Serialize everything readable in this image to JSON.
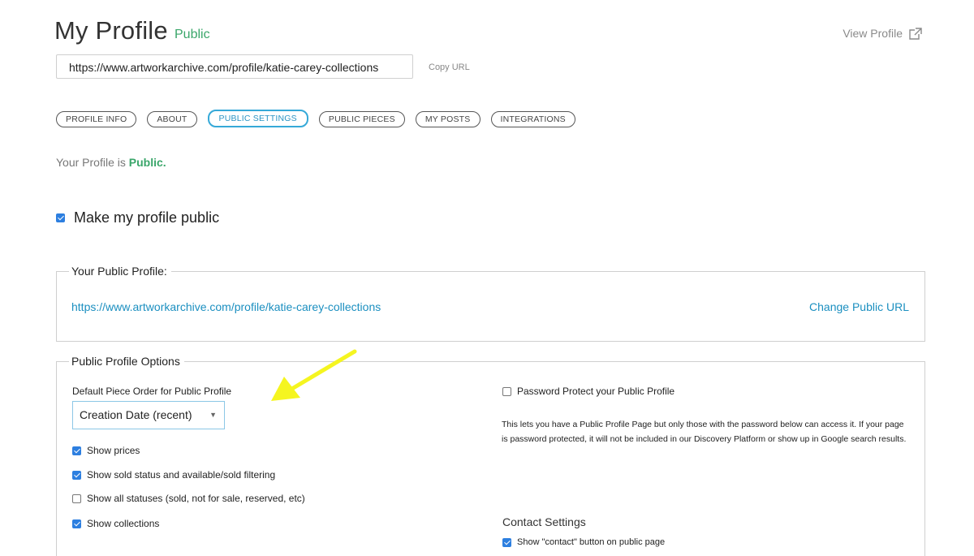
{
  "header": {
    "title": "My Profile",
    "status": "Public",
    "view_profile": "View Profile"
  },
  "url_bar": {
    "value": "https://www.artworkarchive.com/profile/katie-carey-collections",
    "copy_label": "Copy URL"
  },
  "tabs": [
    {
      "label": "PROFILE INFO",
      "active": false
    },
    {
      "label": "ABOUT",
      "active": false
    },
    {
      "label": "PUBLIC SETTINGS",
      "active": true
    },
    {
      "label": "PUBLIC PIECES",
      "active": false
    },
    {
      "label": "MY POSTS",
      "active": false
    },
    {
      "label": "INTEGRATIONS",
      "active": false
    }
  ],
  "profile_status": {
    "prefix": "Your Profile is",
    "value": "Public."
  },
  "make_public": {
    "label": "Make my profile public",
    "checked": true
  },
  "public_profile": {
    "legend": "Your Public Profile:",
    "url": "https://www.artworkarchive.com/profile/katie-carey-collections",
    "change_label": "Change Public URL"
  },
  "options": {
    "legend": "Public Profile Options",
    "order_label": "Default Piece Order for Public Profile",
    "order_value": "Creation Date (recent)",
    "checkboxes": [
      {
        "label": "Show prices",
        "checked": true
      },
      {
        "label": "Show sold status and available/sold filtering",
        "checked": true
      },
      {
        "label": "Show all statuses (sold, not for sale, reserved, etc)",
        "checked": false
      },
      {
        "label": "Show collections",
        "checked": true
      }
    ],
    "password": {
      "label": "Password Protect your Public Profile",
      "checked": false,
      "description": "This lets you have a Public Profile Page but only those with the password below can access it. If your page is password protected, it will not be included in our Discovery Platform or show up in Google search results."
    },
    "contact": {
      "title": "Contact Settings",
      "checkbox_label": "Show \"contact\" button on public page",
      "checked": true
    }
  },
  "colors": {
    "public_green": "#3aa66a",
    "link_blue": "#1b8fc0",
    "active_tab": "#36a9d8",
    "checkbox_blue": "#2d7fe0",
    "annotation_arrow": "#f5f520"
  }
}
